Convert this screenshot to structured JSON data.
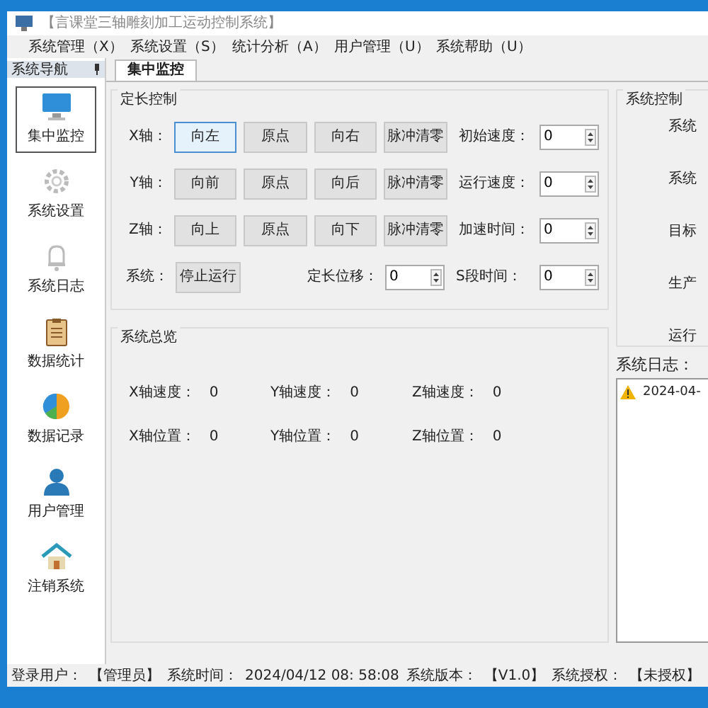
{
  "window": {
    "title": "【言课堂三轴雕刻加工运动控制系统】"
  },
  "menu": [
    "系统管理（X）",
    "系统设置（S）",
    "统计分析（A）",
    "用户管理（U）",
    "系统帮助（U）"
  ],
  "sidebar": {
    "title": "系统导航",
    "items": [
      {
        "label": "集中监控",
        "kind": "monitor",
        "selected": true
      },
      {
        "label": "系统设置",
        "kind": "gear",
        "selected": false
      },
      {
        "label": "系统日志",
        "kind": "bell",
        "selected": false
      },
      {
        "label": "数据统计",
        "kind": "clipboard",
        "selected": false
      },
      {
        "label": "数据记录",
        "kind": "pie",
        "selected": false
      },
      {
        "label": "用户管理",
        "kind": "user",
        "selected": false
      },
      {
        "label": "注销系统",
        "kind": "home",
        "selected": false
      }
    ]
  },
  "tabs": [
    {
      "label": "集中监控",
      "selected": true
    }
  ],
  "fixed_length_control": {
    "title": "定长控制",
    "rows": [
      {
        "label": "X轴：",
        "buttons": [
          {
            "label": "向左",
            "focused": true
          },
          {
            "label": "原点",
            "focused": false
          },
          {
            "label": "向右",
            "focused": false
          },
          {
            "label": "脉冲清零",
            "focused": false
          }
        ],
        "param": {
          "label": "初始速度：",
          "value": "0"
        }
      },
      {
        "label": "Y轴：",
        "buttons": [
          {
            "label": "向前",
            "focused": false
          },
          {
            "label": "原点",
            "focused": false
          },
          {
            "label": "向后",
            "focused": false
          },
          {
            "label": "脉冲清零",
            "focused": false
          }
        ],
        "param": {
          "label": "运行速度：",
          "value": "0"
        }
      },
      {
        "label": "Z轴：",
        "buttons": [
          {
            "label": "向上",
            "focused": false
          },
          {
            "label": "原点",
            "focused": false
          },
          {
            "label": "向下",
            "focused": false
          },
          {
            "label": "脉冲清零",
            "focused": false
          }
        ],
        "param": {
          "label": "加速时间：",
          "value": "0"
        }
      },
      {
        "label": "系统：",
        "buttons": [
          {
            "label": "停止运行",
            "focused": false
          }
        ],
        "offset": {
          "label": "定长位移：",
          "value": "0"
        },
        "param": {
          "label": "S段时间：",
          "value": "0"
        }
      }
    ]
  },
  "overview": {
    "title": "系统总览",
    "items": [
      {
        "label": "X轴速度：",
        "value": "0"
      },
      {
        "label": "Y轴速度：",
        "value": "0"
      },
      {
        "label": "Z轴速度：",
        "value": "0"
      },
      {
        "label": "X轴位置：",
        "value": "0"
      },
      {
        "label": "Y轴位置：",
        "value": "0"
      },
      {
        "label": "Z轴位置：",
        "value": "0"
      }
    ]
  },
  "system_control": {
    "title": "系统控制",
    "labels": [
      "系统",
      "系统",
      "目标",
      "生产",
      "运行"
    ]
  },
  "log": {
    "title": "系统日志：",
    "entries": [
      {
        "kind": "warning",
        "text": "2024-04-"
      }
    ]
  },
  "status_bar": [
    "登录用户：",
    "【管理员】",
    "系统时间：",
    "2024/04/12 08: 58:08",
    "系统版本：",
    "【V1.0】",
    "系统授权：",
    "【未授权】"
  ]
}
